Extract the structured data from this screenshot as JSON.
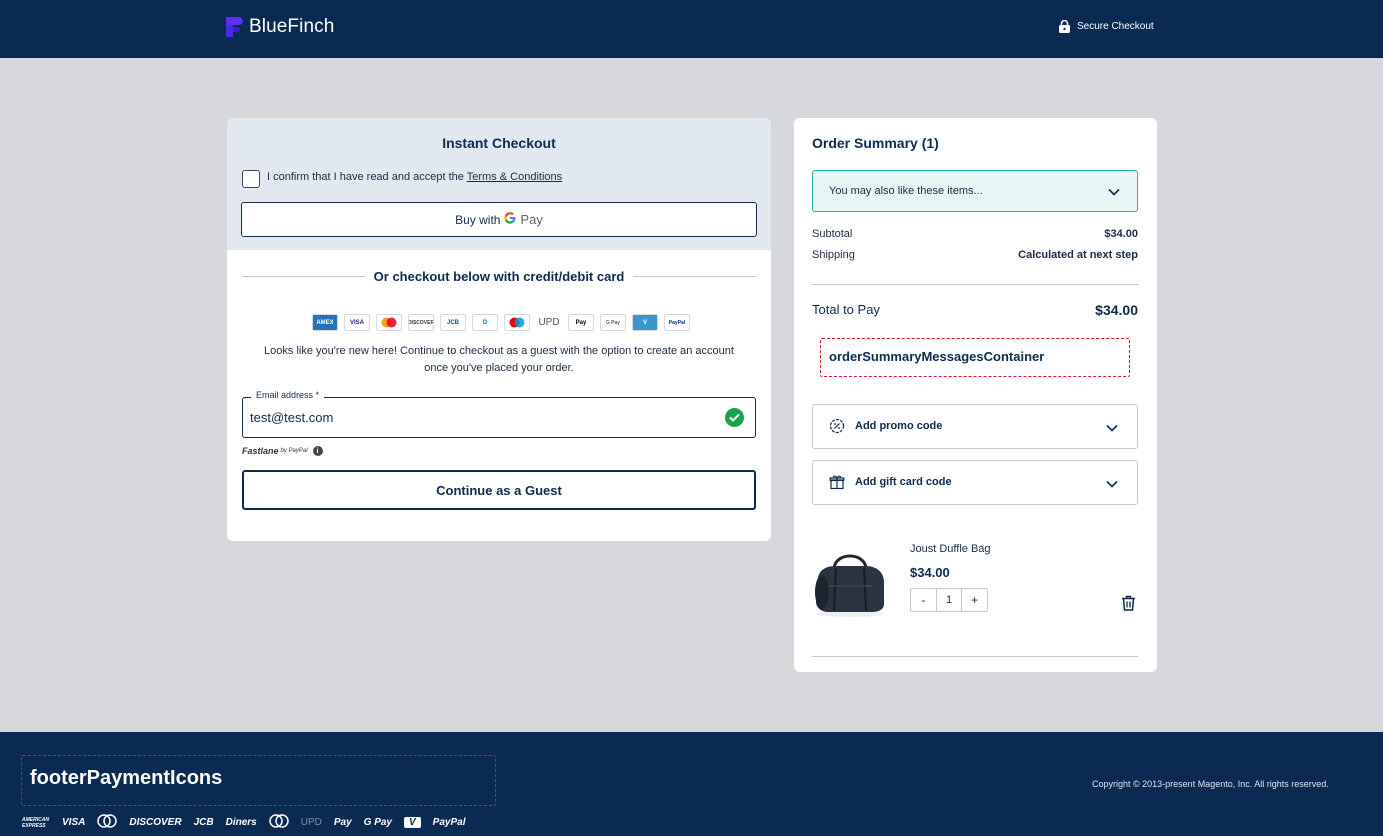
{
  "header": {
    "brand": "BlueFinch",
    "secure_label": "Secure Checkout"
  },
  "instant": {
    "title": "Instant Checkout",
    "terms_prefix": "I confirm that I have read and accept the ",
    "terms_link": "Terms & Conditions",
    "gpay_label": "Buy with",
    "gpay_g": "G",
    "gpay_pay": "Pay"
  },
  "card_section": {
    "divider_text": "Or checkout below with credit/debit card",
    "card_icons": [
      {
        "name": "amex-icon",
        "text": "AMEX",
        "bg": "#2671b9",
        "fg": "#ffffff"
      },
      {
        "name": "visa-icon",
        "text": "VISA",
        "bg": "#ffffff",
        "fg": "#1a1f71"
      },
      {
        "name": "mastercard-icon",
        "text": "",
        "bg": "#ffffff",
        "fg": "#000000"
      },
      {
        "name": "discover-icon",
        "text": "DISCOVER",
        "bg": "#ffffff",
        "fg": "#333333"
      },
      {
        "name": "jcb-icon",
        "text": "JCB",
        "bg": "#ffffff",
        "fg": "#0b4ea2"
      },
      {
        "name": "diners-icon",
        "text": "D",
        "bg": "#ffffff",
        "fg": "#0079be"
      },
      {
        "name": "maestro-icon",
        "text": "",
        "bg": "#ffffff",
        "fg": "#000000"
      },
      {
        "name": "upd-icon",
        "text": "UPD",
        "bg": "#ffffff",
        "fg": "#555555"
      },
      {
        "name": "apple-pay-icon",
        "text": " Pay",
        "bg": "#ffffff",
        "fg": "#000000"
      },
      {
        "name": "google-pay-icon",
        "text": "G Pay",
        "bg": "#ffffff",
        "fg": "#5f6368"
      },
      {
        "name": "venmo-icon",
        "text": "V",
        "bg": "#3d95ce",
        "fg": "#ffffff"
      },
      {
        "name": "paypal-icon",
        "text": "PayPal",
        "bg": "#ffffff",
        "fg": "#003087"
      }
    ],
    "new_here_text": "Looks like you're new here! Continue to checkout as a guest with the option to create an account once you've placed your order."
  },
  "email": {
    "label": "Email address *",
    "value": "test@test.com"
  },
  "fastlane": {
    "brand": "Fastlane",
    "by": "by PayPal"
  },
  "guest_button": "Continue as a Guest",
  "order_summary": {
    "title": "Order Summary (1)",
    "upsell": "You may also like these items...",
    "subtotal_label": "Subtotal",
    "subtotal_value": "$34.00",
    "shipping_label": "Shipping",
    "shipping_value": "Calculated at next step",
    "total_label": "Total to Pay",
    "total_value": "$34.00",
    "messages_container": "orderSummaryMessagesContainer",
    "promo_label": "Add promo code",
    "giftcard_label": "Add gift card code",
    "item": {
      "name": "Joust Duffle Bag",
      "price": "$34.00",
      "qty": "1",
      "minus": "-",
      "plus": "+"
    }
  },
  "footer": {
    "icons_container": "footerPaymentIcons",
    "copyright": "Copyright © 2013-present Magento, Inc. All rights reserved.",
    "payment_icons": [
      "AMERICAN EXPRESS",
      "VISA",
      "mastercard",
      "DISCOVER",
      "JCB",
      "Diners",
      "maestro",
      "UPD",
      " Pay",
      "G Pay",
      "V",
      "PayPal"
    ]
  },
  "colors": {
    "navy": "#0a2a52",
    "accent_teal": "#2cb6a6",
    "success": "#1aa34a",
    "dashed_red": "#d21a2a"
  }
}
